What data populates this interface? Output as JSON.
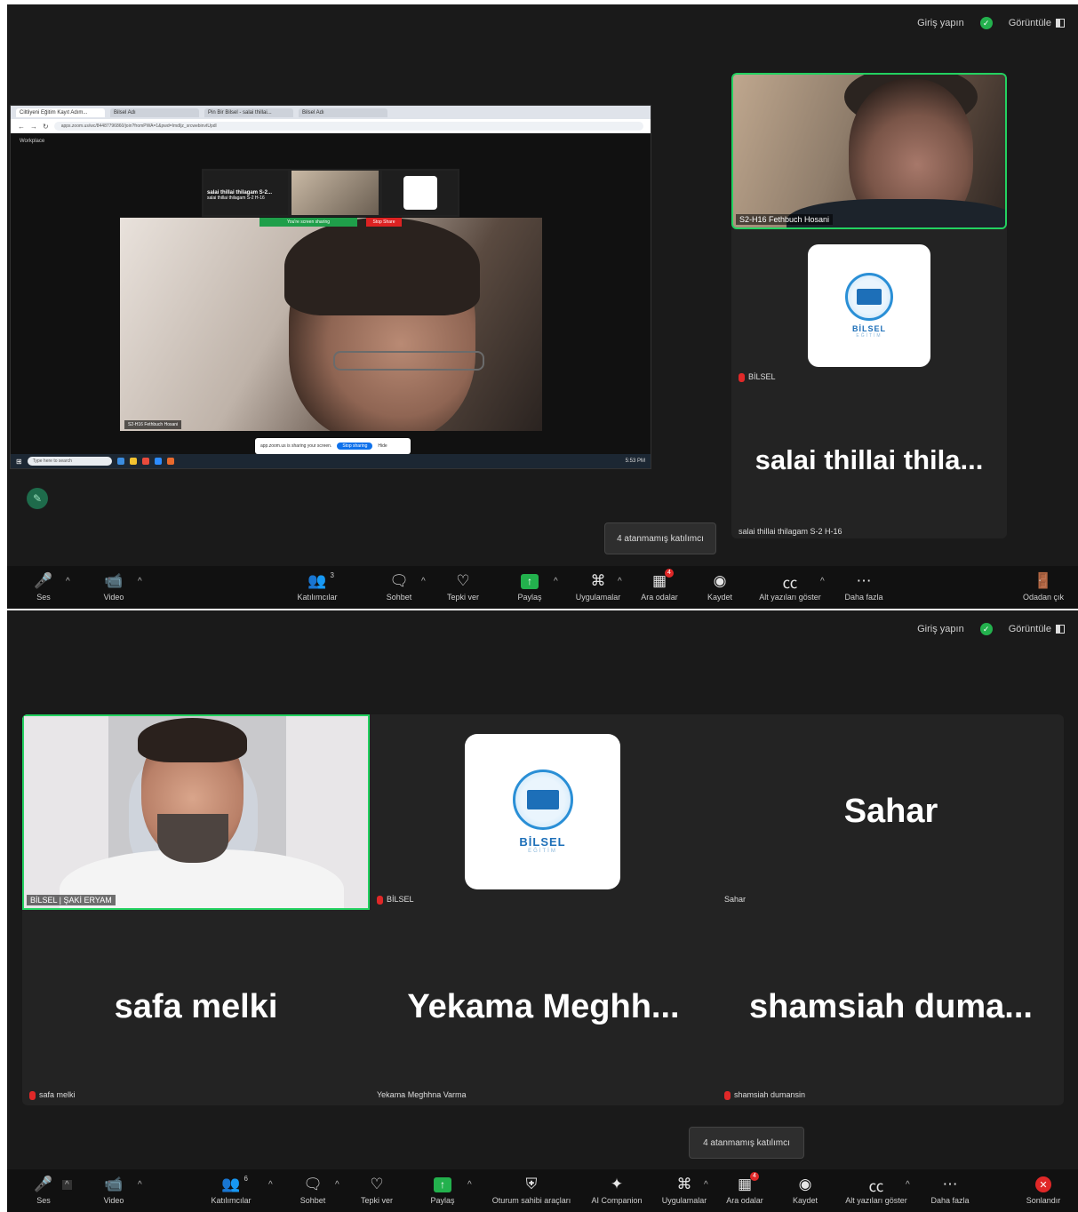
{
  "top": {
    "signin": "Giriş yapın",
    "view": "Görüntüle"
  },
  "window1": {
    "shared_screen": {
      "tabs": [
        "Ciltliyeni Eğitim Kayıt Adım...",
        "Bilsel Adı",
        "Pin Bir Bilsel - salai thillai...",
        "Bilsel Adı"
      ],
      "url": "apps.zoom.us/wc/84487796860/join?fromPWA=1&pwd=ImdIjz_srcwebinvtUpdl",
      "inner_app_name": "Workplace",
      "inner_strip_name": "salai thillai thilagam S-2...",
      "inner_strip_sub": "salai thillai thilagam S-2 H-16",
      "inner_green_pill": "You're screen sharing",
      "inner_red_pill": "Stop Share",
      "inner_label": "S2-H16 Fethbuch Hosani",
      "inner_toast_text": "app.zoom.us is sharing your screen.",
      "inner_toast_btn": "Stop sharing",
      "inner_toast_hide": "Hide",
      "taskbar_search": "Type here to search",
      "taskbar_time": "5:53 PM"
    },
    "rpanel": {
      "video_label": "S2-H16 Fethbuch Hosani",
      "logo_text": "BİLSEL",
      "logo_sub": "EĞİTİM",
      "logo_name": "BİLSEL",
      "big_name": "salai thillai thila...",
      "small_name": "salai thillai thilagam S-2 H-16"
    },
    "tooltip": "4 atanmamış katılımcı",
    "toolbar": {
      "audio": "Ses",
      "video": "Video",
      "participants": "Katılımcılar",
      "participants_count": "3",
      "chat": "Sohbet",
      "react": "Tepki ver",
      "share": "Paylaş",
      "apps": "Uygulamalar",
      "rooms": "Ara odalar",
      "rooms_badge": "4",
      "record": "Kaydet",
      "captions": "Alt yazıları göster",
      "more": "Daha fazla",
      "leave": "Odadan çık"
    }
  },
  "window2": {
    "tiles": [
      {
        "name": "BİLSEL | ŞAKİ ERYAM"
      },
      {
        "name": "BİLSEL",
        "logo_text": "BİLSEL",
        "logo_sub": "EĞİTİM"
      },
      {
        "name": "Sahar",
        "big": "Sahar"
      },
      {
        "name": "safa melki",
        "big": "safa melki"
      },
      {
        "name": "Yekama Meghhna Varma",
        "big": "Yekama  Meghh..."
      },
      {
        "name": "shamsiah dumansin",
        "big": "shamsiah  duma..."
      }
    ],
    "tooltip": "4 atanmamış katılımcı",
    "toolbar": {
      "audio": "Ses",
      "video": "Video",
      "participants": "Katılımcılar",
      "participants_count": "6",
      "chat": "Sohbet",
      "react": "Tepki ver",
      "share": "Paylaş",
      "host_tools": "Oturum sahibi araçları",
      "companion": "AI Companion",
      "apps": "Uygulamalar",
      "rooms": "Ara odalar",
      "rooms_badge": "4",
      "record": "Kaydet",
      "captions": "Alt yazıları göster",
      "more": "Daha fazla",
      "end": "Sonlandır"
    }
  }
}
